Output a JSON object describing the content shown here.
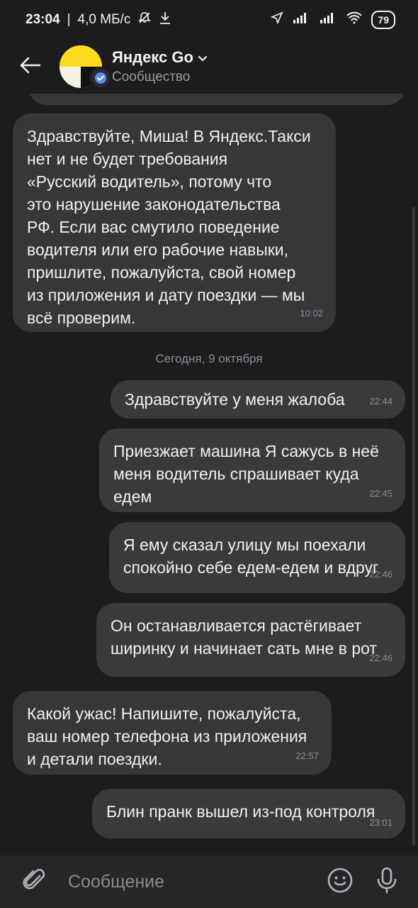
{
  "status": {
    "time": "23:04",
    "speed": "4,0 МБ/с",
    "battery": "79"
  },
  "header": {
    "title": "Яндекс Go",
    "subtitle": "Сообщество"
  },
  "messages": [
    {
      "direction": "incoming",
      "text": "Здравствуйте, Миша! В Яндекс.Такси\nнет и не будет требования\n«Русский водитель», потому что\nэто нарушение законодательства\nРФ. Если вас смутило поведение\nводителя или его рабочие навыки,\nпришлите, пожалуйста, свой номер\nиз приложения и дату поездки — мы\nвсё проверим.",
      "time": "10:02"
    },
    {
      "direction": "outgoing",
      "text": "Здравствуйте у меня жалоба",
      "time": "22:44"
    },
    {
      "direction": "outgoing",
      "text": "Приезжает машина Я сажусь в неё\nменя водитель спрашивает куда\nедем",
      "time": "22:45"
    },
    {
      "direction": "outgoing",
      "text": "Я ему сказал улицу мы поехали\nспокойно себе едем-едем и вдруг",
      "time": "22:46"
    },
    {
      "direction": "outgoing",
      "text": "Он останавливается растёгивает\nширинку и начинает сать мне в рот",
      "time": "22:46"
    },
    {
      "direction": "incoming",
      "text": "Какой ужас! Напишите, пожалуйста,\nваш номер телефона из приложения\nи детали поездки.",
      "time": "22:57"
    },
    {
      "direction": "outgoing",
      "text": "Блин пранк вышел из-под контроля",
      "time": "23:01"
    }
  ],
  "date_separator": "Сегодня, 9 октября",
  "composer": {
    "placeholder": "Сообщение"
  },
  "colors": {
    "background": "#1c1c1e",
    "bubble": "#3a3a3c",
    "brand_yellow": "#fddb21"
  },
  "icons": {
    "back": "back-arrow-icon",
    "verified": "verified-check-icon",
    "attach": "paperclip-icon",
    "emoji": "emoji-icon",
    "mic": "microphone-icon"
  }
}
